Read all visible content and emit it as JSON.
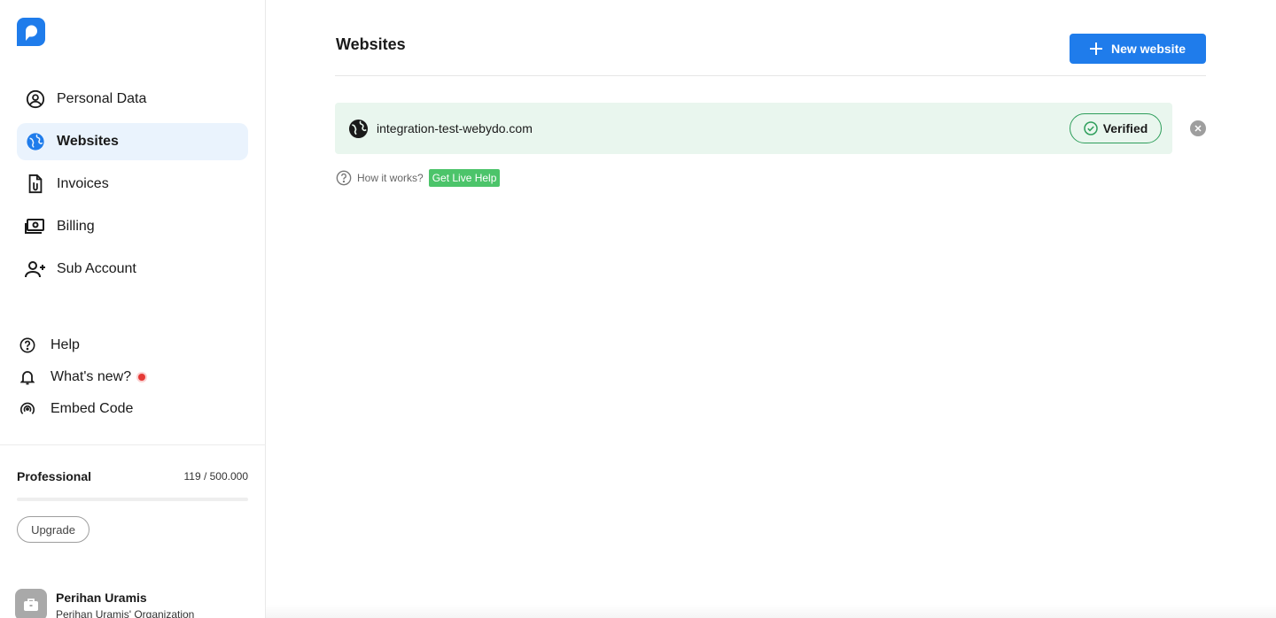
{
  "sidebar": {
    "logo_icon": "chat-bubble-logo",
    "nav": [
      {
        "label": "Personal Data",
        "icon": "user-circle-icon",
        "active": false
      },
      {
        "label": "Websites",
        "icon": "globe-icon",
        "active": true
      },
      {
        "label": "Invoices",
        "icon": "document-icon",
        "active": false
      },
      {
        "label": "Billing",
        "icon": "cash-icon",
        "active": false
      },
      {
        "label": "Sub Account",
        "icon": "user-plus-icon",
        "active": false
      }
    ],
    "secondary": [
      {
        "label": "Help",
        "icon": "question-circle-icon"
      },
      {
        "label": "What's new?",
        "icon": "bell-icon"
      },
      {
        "label": "Embed Code",
        "icon": "broadcast-icon"
      }
    ],
    "plan": {
      "name": "Professional",
      "usage": "119 / 500.000",
      "progress_fraction": 0.000238,
      "upgrade_label": "Upgrade"
    },
    "user": {
      "name": "Perihan Uramis",
      "organization": "Perihan Uramis' Organization"
    }
  },
  "main": {
    "title": "Websites",
    "new_button_label": "New website",
    "websites": [
      {
        "url": "integration-test-webydo.com",
        "status": "Verified"
      }
    ],
    "help": {
      "text": "How it works?",
      "live_help_label": "Get Live Help"
    }
  },
  "colors": {
    "accent": "#1f7ceb",
    "active_nav_bg": "#eaf3fd",
    "verified_row_bg": "#e9f6ee",
    "verified_border": "#2e9e5b",
    "live_help_bg": "#4cc46a",
    "notification_dot": "#e53935"
  }
}
